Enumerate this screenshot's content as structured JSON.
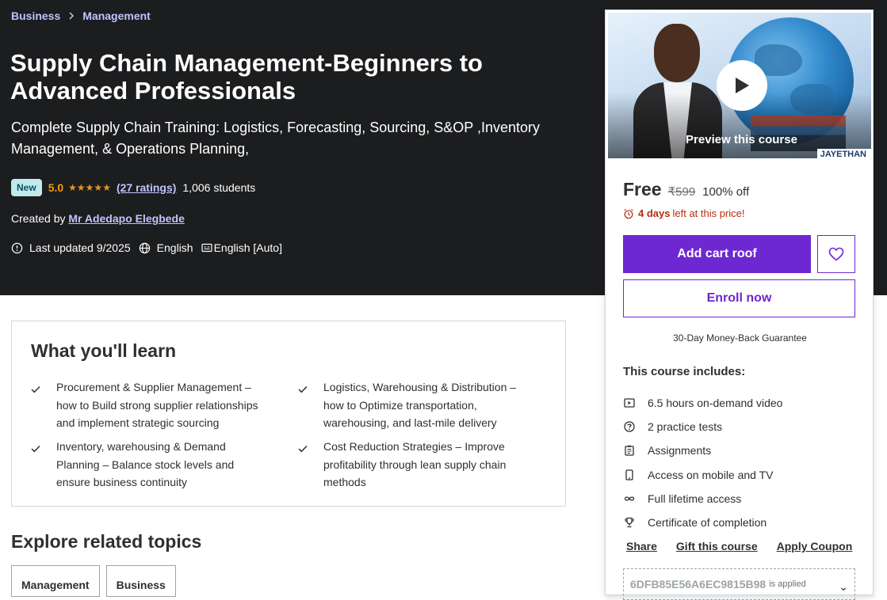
{
  "breadcrumb": {
    "items": [
      "Business",
      "Management"
    ]
  },
  "course": {
    "title": "Supply Chain Management-Beginners to Advanced Professionals",
    "subtitle": "Complete Supply Chain Training: Logistics, Forecasting, Sourcing, S&OP ,Inventory Management, & Operations Planning,",
    "badge": "New",
    "rating": "5.0",
    "stars": 5,
    "ratings_count": "(27 ratings)",
    "students": "1,006 students",
    "created_by_label": "Created by",
    "instructor": "Mr Adedapo Elegbede",
    "last_updated": "Last updated 9/2025",
    "language": "English",
    "captions": "English [Auto]"
  },
  "sidebar": {
    "preview_label": "Preview this course",
    "brand_tag": "JAYETHAN",
    "price_now": "Free",
    "price_old": "₹599",
    "discount": "100% off",
    "timer_prefix": "",
    "timer_bold": "4 days",
    "timer_suffix": "left at this price!",
    "add_cart_label": "Add cart roof",
    "enroll_label": "Enroll now",
    "guarantee": "30-Day Money-Back Guarantee",
    "includes_title": "This course includes:",
    "includes": [
      {
        "icon": "video-icon",
        "label": "6.5 hours on-demand video"
      },
      {
        "icon": "help-circle-icon",
        "label": "2 practice tests"
      },
      {
        "icon": "clipboard-icon",
        "label": "Assignments"
      },
      {
        "icon": "mobile-icon",
        "label": "Access on mobile and TV"
      },
      {
        "icon": "infinity-icon",
        "label": "Full lifetime access"
      },
      {
        "icon": "trophy-icon",
        "label": "Certificate of completion"
      }
    ],
    "links": [
      "Share",
      "Gift this course",
      "Apply Coupon"
    ],
    "coupon_code": "6DFB85E56A6EC9815B98",
    "coupon_status": "is applied"
  },
  "learn": {
    "title": "What you'll learn",
    "items": [
      "Procurement & Supplier Management – how to Build strong supplier relationships and implement strategic sourcing",
      "Logistics, Warehousing & Distribution – how to Optimize transportation, warehousing, and last-mile delivery",
      "Inventory, warehousing & Demand Planning – Balance stock levels and ensure business continuity",
      "Cost Reduction Strategies – Improve profitability through lean supply chain methods"
    ]
  },
  "explore": {
    "title": "Explore related topics",
    "topics": [
      "Management",
      "Business"
    ]
  },
  "colors": {
    "hero_bg": "#1c1d1f",
    "accent": "#6d28d2",
    "link": "#c0c4fc",
    "star": "#e59819",
    "urgent": "#b32d0f"
  }
}
